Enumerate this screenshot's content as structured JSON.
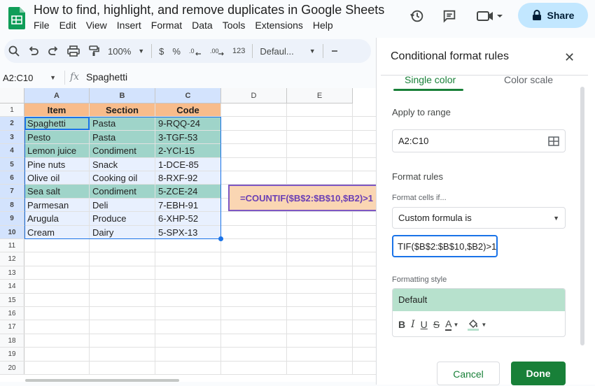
{
  "app": {
    "title": "How to find, highlight, and remove duplicates in Google Sheets",
    "menu": [
      "File",
      "Edit",
      "View",
      "Insert",
      "Format",
      "Data",
      "Tools",
      "Extensions",
      "Help"
    ],
    "share_label": "Share"
  },
  "toolbar": {
    "zoom": "100%",
    "currency": "$",
    "percent": "%",
    "number_format": "123",
    "font": "Defaul..."
  },
  "formula_bar": {
    "cell_ref": "A2:C10",
    "fx": "fx",
    "value": "Spaghetti"
  },
  "sheet": {
    "columns": [
      "A",
      "B",
      "C",
      "D",
      "E"
    ],
    "row_numbers": [
      "1",
      "2",
      "3",
      "4",
      "5",
      "6",
      "7",
      "8",
      "9",
      "10",
      "11",
      "12",
      "13",
      "14",
      "15",
      "16",
      "17",
      "18",
      "19",
      "20"
    ],
    "headers": [
      "Item",
      "Section",
      "Code"
    ],
    "rows": [
      {
        "item": "Spaghetti",
        "section": "Pasta",
        "code": "9-RQQ-24",
        "highlight": true
      },
      {
        "item": "Pesto",
        "section": "Pasta",
        "code": "3-TGF-53",
        "highlight": true
      },
      {
        "item": "Lemon juice",
        "section": "Condiment",
        "code": "2-YCI-15",
        "highlight": true
      },
      {
        "item": "Pine nuts",
        "section": "Snack",
        "code": "1-DCE-85",
        "highlight": false
      },
      {
        "item": "Olive oil",
        "section": "Cooking oil",
        "code": "8-RXF-92",
        "highlight": false
      },
      {
        "item": "Sea salt",
        "section": "Condiment",
        "code": "5-ZCE-24",
        "highlight": true
      },
      {
        "item": "Parmesan",
        "section": "Deli",
        "code": "7-EBH-91",
        "highlight": false
      },
      {
        "item": "Arugula",
        "section": "Produce",
        "code": "6-XHP-52",
        "highlight": false
      },
      {
        "item": "Cream",
        "section": "Dairy",
        "code": "5-SPX-13",
        "highlight": false
      }
    ]
  },
  "callout": {
    "text": "=COUNTIF($B$2:$B$10,$B2)>1"
  },
  "panel": {
    "title": "Conditional format rules",
    "tabs": [
      "Single color",
      "Color scale"
    ],
    "apply_label": "Apply to range",
    "range": "A2:C10",
    "rules_label": "Format rules",
    "cells_if_label": "Format cells if...",
    "condition": "Custom formula is",
    "formula_visible": "TIF($B$2:$B$10,$B2)>1",
    "style_label": "Formatting style",
    "style_preview": "Default",
    "style_buttons": [
      "B",
      "I",
      "U",
      "S",
      "A"
    ],
    "cancel_label": "Cancel",
    "done_label": "Done"
  },
  "colors": {
    "header_fill": "#f8bc8b",
    "highlight_fill": "#9fd4c9",
    "selection_fill": "#e8f0fe",
    "selection_border": "#1a73e8",
    "accent_green": "#188038",
    "callout_border": "#7e57c2"
  }
}
